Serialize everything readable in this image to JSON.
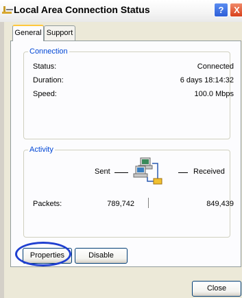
{
  "window": {
    "title": "Local Area Connection Status",
    "help_glyph": "?",
    "close_glyph": "X"
  },
  "tabs": [
    {
      "label": "General"
    },
    {
      "label": "Support"
    }
  ],
  "connection": {
    "legend": "Connection",
    "rows": [
      {
        "label": "Status:",
        "value": "Connected"
      },
      {
        "label": "Duration:",
        "value": "6 days 18:14:32"
      },
      {
        "label": "Speed:",
        "value": "100.0 Mbps"
      }
    ]
  },
  "activity": {
    "legend": "Activity",
    "sent_label": "Sent",
    "received_label": "Received",
    "packets_label": "Packets:",
    "packets_sent": "789,742",
    "packets_received": "849,439"
  },
  "buttons": {
    "properties": "Properties",
    "disable": "Disable",
    "close": "Close"
  },
  "icons": [
    "network-connection-icon",
    "help-icon",
    "close-icon",
    "network-activity-icon"
  ]
}
